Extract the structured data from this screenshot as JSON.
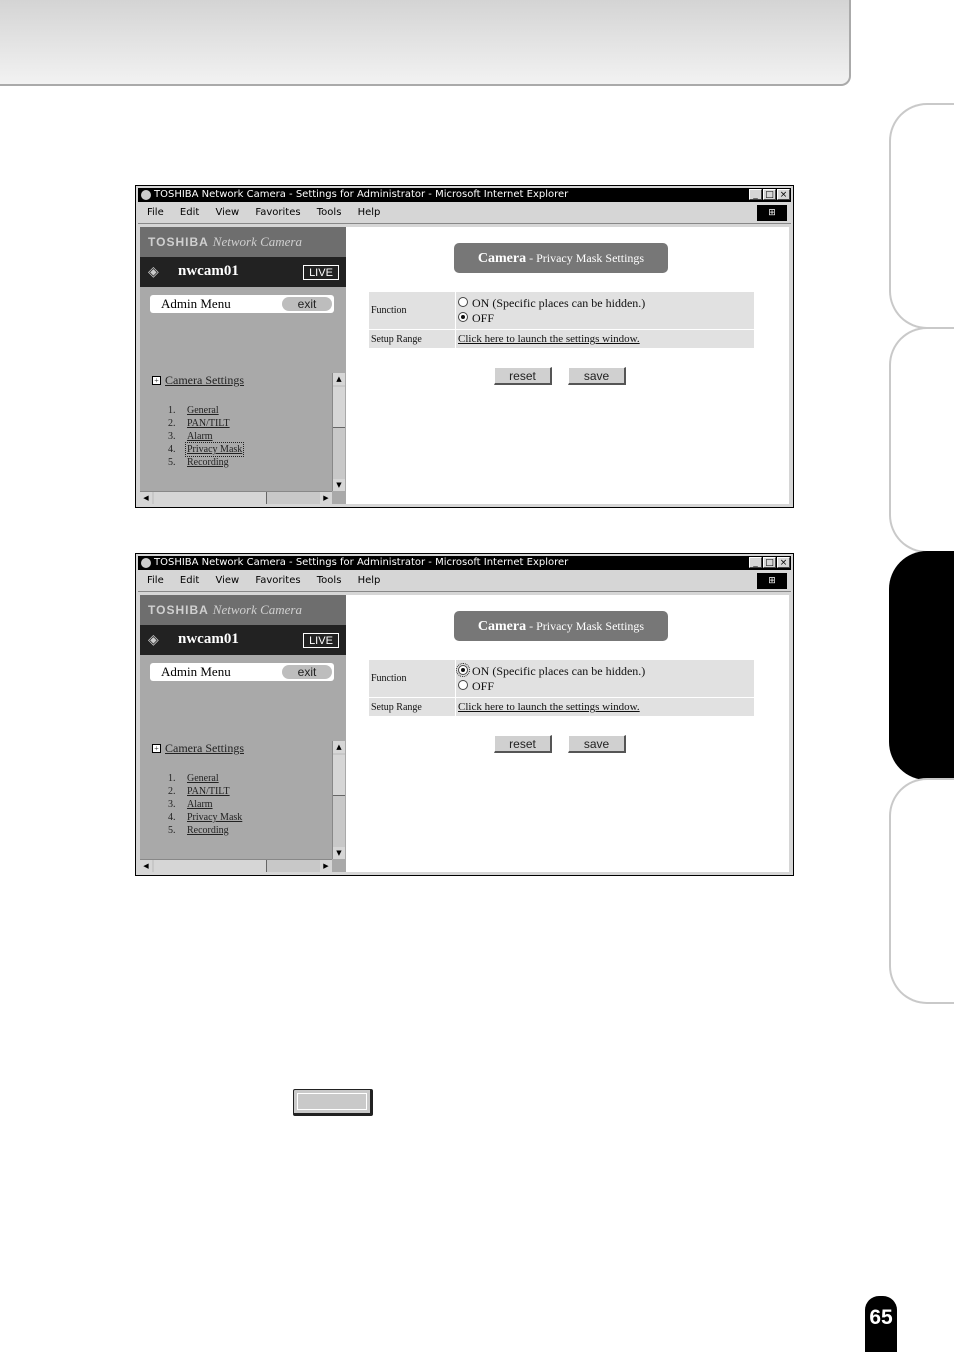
{
  "browser": {
    "title": "TOSHIBA Network Camera - Settings for Administrator - Microsoft Internet Explorer",
    "window_buttons": [
      "_",
      "□",
      "×"
    ],
    "menu": [
      "File",
      "Edit",
      "View",
      "Favorites",
      "Tools",
      "Help"
    ]
  },
  "sidebar": {
    "brand": "TOSHIBA",
    "brand_sub": "Network Camera",
    "camera_name": "nwcam01",
    "live_label": "LIVE",
    "admin_menu": "Admin Menu",
    "exit_label": "exit",
    "section_title": "Camera Settings",
    "section_toggle": "+",
    "items": [
      {
        "num": "1.",
        "label": "General"
      },
      {
        "num": "2.",
        "label": "PAN/TILT"
      },
      {
        "num": "3.",
        "label": "Alarm"
      },
      {
        "num": "4.",
        "label": "Privacy Mask"
      },
      {
        "num": "5.",
        "label": "Recording"
      }
    ]
  },
  "panel": {
    "title_bold": "Camera",
    "title_rest": " - Privacy Mask Settings",
    "function_label": "Function",
    "on_label": "ON  (Specific places can be hidden.)",
    "off_label": "OFF",
    "setup_range_label": "Setup Range",
    "setup_link": "Click here to launch the settings window.",
    "reset_label": "reset",
    "save_label": "save"
  },
  "screens": [
    {
      "function_value": "OFF"
    },
    {
      "function_value": "ON"
    }
  ],
  "page_number": "65"
}
